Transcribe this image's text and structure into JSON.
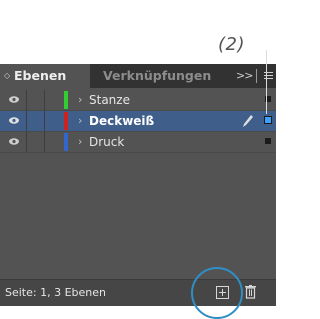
{
  "annotation_label": "(2)",
  "tabs": [
    {
      "label": "Ebenen",
      "active": true
    },
    {
      "label": "Verknüpfungen",
      "active": false
    }
  ],
  "overflow_label": ">>",
  "layers": [
    {
      "name": "Stanze",
      "color": "#33cc33",
      "visible": true,
      "selected": false
    },
    {
      "name": "Deckweiß",
      "color": "#cc2222",
      "visible": true,
      "selected": true
    },
    {
      "name": "Druck",
      "color": "#3366cc",
      "visible": true,
      "selected": false
    }
  ],
  "status": "Seite: 1, 3 Ebenen",
  "icons": {
    "eye": "eye-icon",
    "chevron": "chevron-right-icon",
    "pen": "pen-icon",
    "new_layer": "new-layer-icon",
    "trash": "trash-icon",
    "panel_menu": "panel-menu-icon"
  },
  "colors": {
    "panel_bg": "#535353",
    "tabbar_bg": "#323232",
    "selection": "#3f5f8a",
    "annotation": "#2f8fc4"
  }
}
